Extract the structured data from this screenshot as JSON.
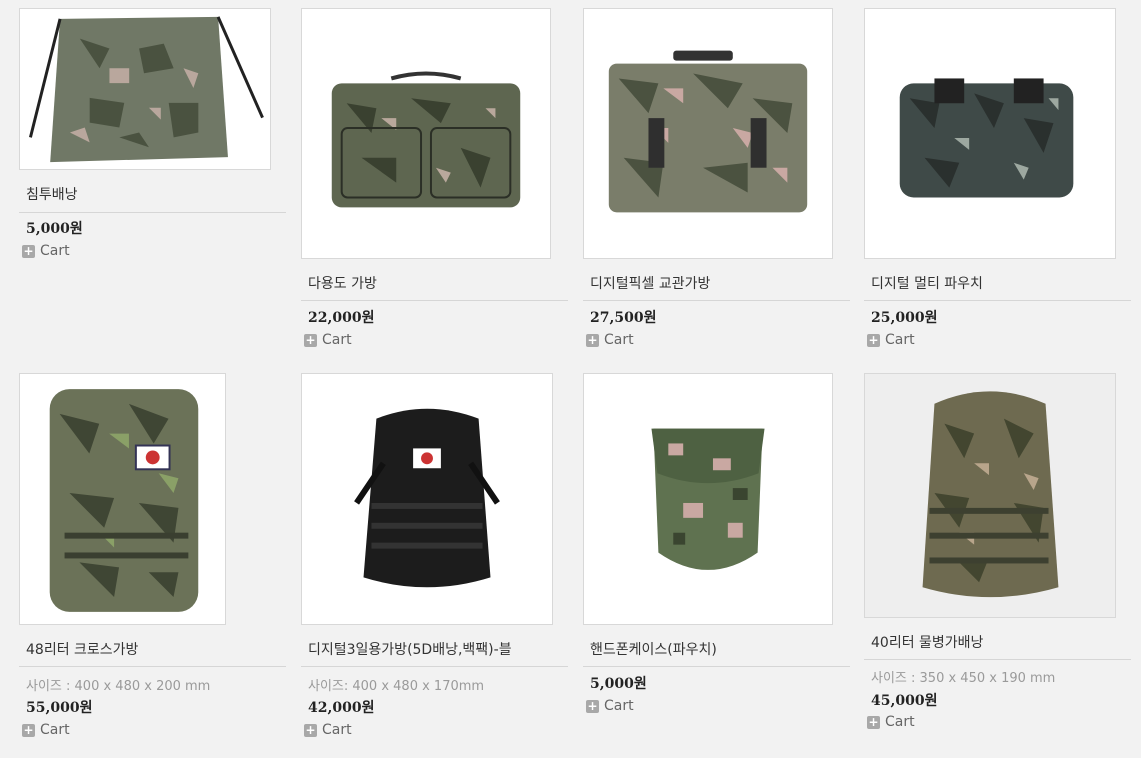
{
  "products": [
    {
      "name": "침투배낭",
      "spec": "",
      "price": "5,000원",
      "cart": "Cart"
    },
    {
      "name": "다용도 가방",
      "spec": "",
      "price": "22,000원",
      "cart": "Cart"
    },
    {
      "name": "디지털픽셀 교관가방",
      "spec": "",
      "price": "27,500원",
      "cart": "Cart"
    },
    {
      "name": "디지털 멀티 파우치",
      "spec": "",
      "price": "25,000원",
      "cart": "Cart"
    },
    {
      "name": "48리터 크로스가방",
      "spec": "사이즈 : 400 x 480 x 200 mm",
      "price": "55,000원",
      "cart": "Cart"
    },
    {
      "name": "디지털3일용가방(5D배낭,백팩)-블",
      "spec": "사이즈: 400 x 480 x 170mm",
      "price": "42,000원",
      "cart": "Cart"
    },
    {
      "name": "핸드폰케이스(파우치)",
      "spec": "",
      "price": "5,000원",
      "cart": "Cart"
    },
    {
      "name": "40리터 물병가배낭",
      "spec": "사이즈 : 350 x 450 x 190 mm",
      "price": "45,000원",
      "cart": "Cart"
    }
  ],
  "colors": {
    "camo_base": "#6e7560",
    "camo_dark": "#3f4636",
    "camo_light": "#b8a89a",
    "camo_pink": "#c9a8a2",
    "black_bag": "#1c1c1c"
  }
}
